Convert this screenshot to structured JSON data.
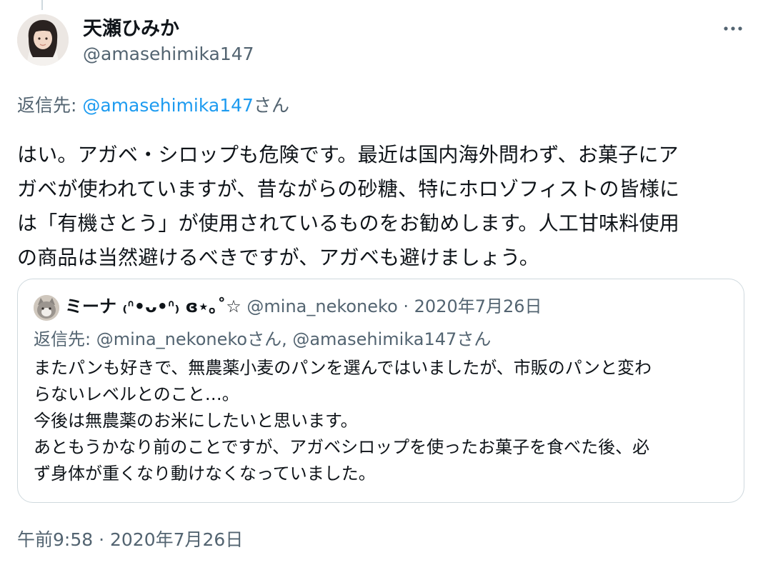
{
  "author": {
    "display_name": "天瀬ひみか",
    "handle": "@amasehimika147"
  },
  "reply_to": {
    "prefix": "返信先: ",
    "handle": "@amasehimika147",
    "suffix": "さん"
  },
  "tweet": {
    "text": "はい。アガベ・シロップも危険です。最近は国内海外問わず、お菓子にア\nガベが使われていますが、昔ながらの砂糖、特にホロゾフィストの皆様に\nは「有機さとう」が使用されているものをお勧めします。人工甘味料使用\nの商品は当然避けるべきですが、アガベも避けましょう。",
    "timestamp": "午前9:58 · 2020年7月26日"
  },
  "quoted": {
    "display_name": "ミーナ ₍ᐢ•ᴗ•ᐢ₎ ɞ⋆｡˚☆",
    "handle": "@mina_nekoneko",
    "separator": " · ",
    "date": "2020年7月26日",
    "reply_prefix": "返信先: ",
    "reply_handles": "@mina_nekonekoさん, @amasehimika147さん",
    "text": "またパンも好きで、無農薬小麦のパンを選んではいましたが、市販のパンと変わ\nらないレベルとのこと…。\n今後は無農薬のお米にしたいと思います。\nあともうかなり前のことですが、アガベシロップを使ったお菓子を食べた後、必\nず身体が重くなり動けなくなっていました。"
  },
  "icons": {
    "more": "more-horizontal-icon",
    "author_avatar": "profile-photo",
    "quoted_avatar": "cat-profile-photo"
  },
  "colors": {
    "link": "#1d9bf0",
    "secondary_text": "#536471",
    "border": "#cfd9de"
  }
}
